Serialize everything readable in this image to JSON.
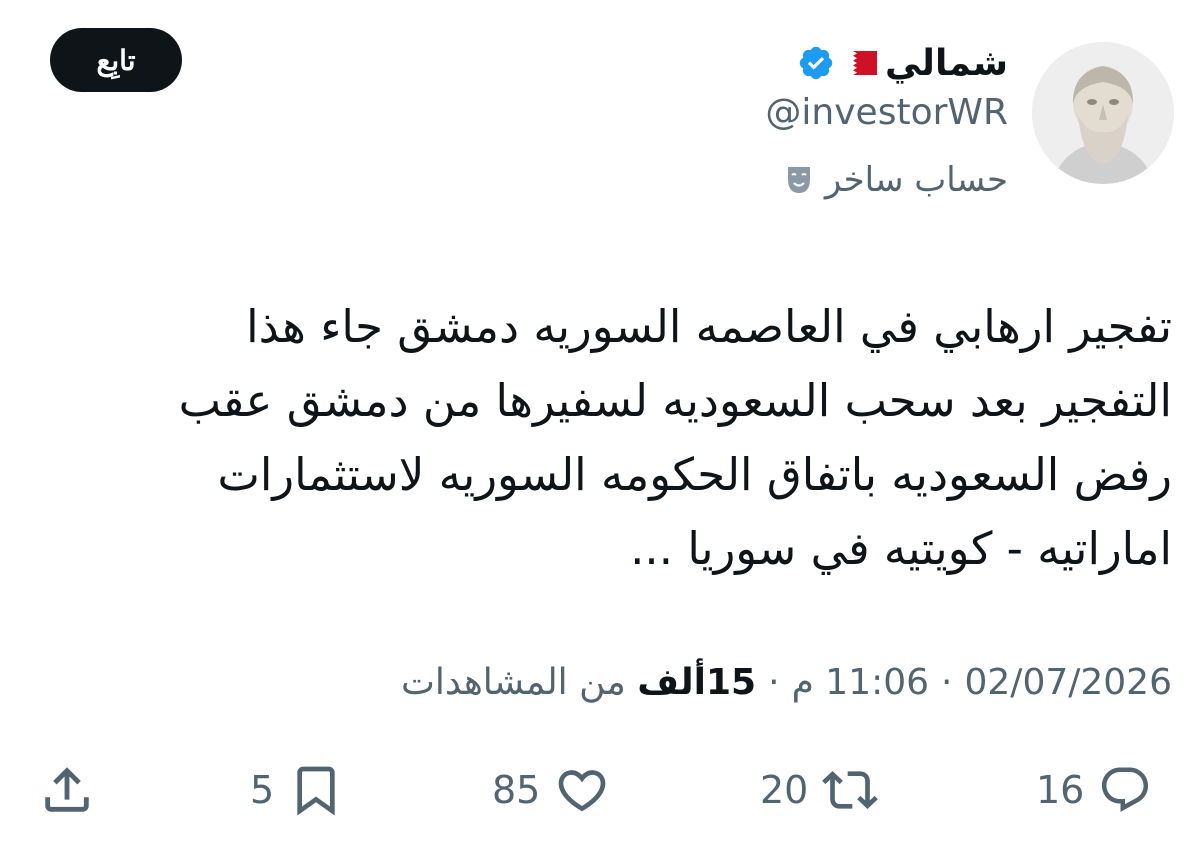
{
  "header": {
    "display_name": "شمالي",
    "handle": "@investorWR",
    "account_label": "حساب ساخر",
    "follow_label": "تابِع"
  },
  "icons": {
    "flag": "bahrain-flag-icon",
    "verified": "verified-badge-icon",
    "label": "theater-mask-icon",
    "reply": "reply-icon",
    "repost": "repost-icon",
    "like": "like-icon",
    "bookmark": "bookmark-icon",
    "share": "share-icon"
  },
  "colors": {
    "verified": "#1d9bf0",
    "text": "#0f1419",
    "secondary": "#536471",
    "button_bg": "#0f1419"
  },
  "tweet": {
    "lines": [
      "تفجير ارهابي في العاصمه السوريه دمشق جاء هذا",
      "التفجير بعد سحب السعوديه لسفيرها من دمشق عقب",
      "رفض السعوديه باتفاق الحكومه السوريه لاستثمارات",
      "اماراتيه - كويتيه في سوريا ..."
    ]
  },
  "meta": {
    "date": "02/07/2026",
    "time": "11:06 م",
    "views_count": "15ألف",
    "views_label": "من المشاهدات"
  },
  "actions": {
    "replies": "16",
    "reposts": "20",
    "likes": "85",
    "bookmarks": "5"
  }
}
